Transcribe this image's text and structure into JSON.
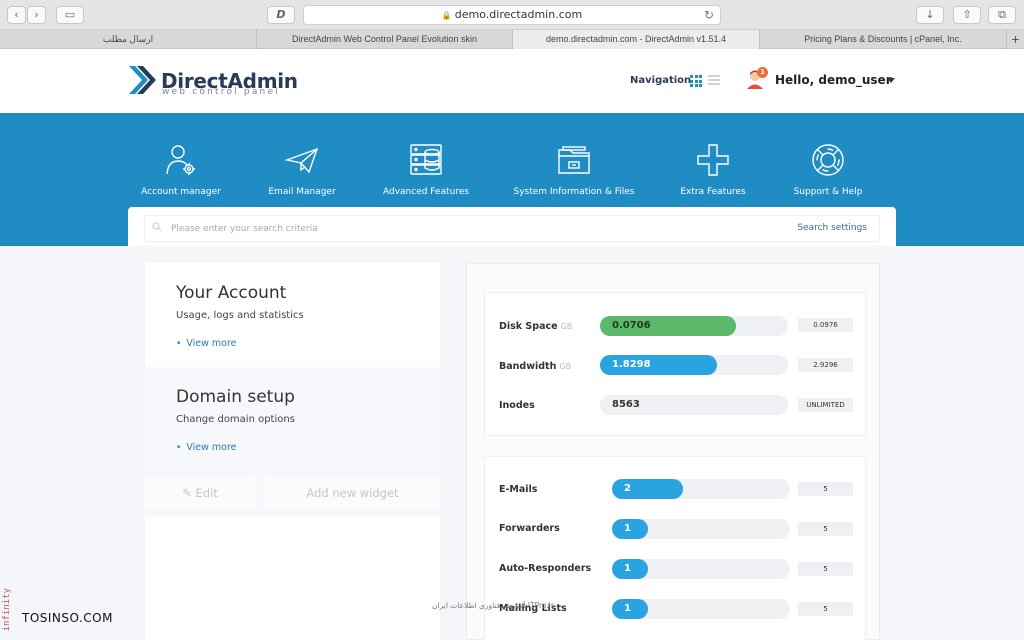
{
  "browser": {
    "url": "demo.directadmin.com",
    "tabs": [
      {
        "label": "ارسال مطلب"
      },
      {
        "label": "DirectAdmin Web Control Panel Evolution skin"
      },
      {
        "label": "demo.directadmin.com - DirectAdmin v1.51.4"
      },
      {
        "label": "Pricing Plans & Discounts | cPanel, Inc."
      }
    ],
    "new_tab": "+",
    "d_logo": "D"
  },
  "header": {
    "brand": "DirectAdmin",
    "brand_sub": "web control panel",
    "navigation_label": "Navigation",
    "notification_count": "1",
    "greeting": "Hello, demo_user"
  },
  "menu": [
    {
      "label": "Account manager",
      "icon": "account-manager-icon"
    },
    {
      "label": "Email Manager",
      "icon": "paper-plane-icon"
    },
    {
      "label": "Advanced Features",
      "icon": "server-database-icon"
    },
    {
      "label": "System Information & Files",
      "icon": "folder-icon"
    },
    {
      "label": "Extra Features",
      "icon": "plus-icon"
    },
    {
      "label": "Support & Help",
      "icon": "lifebuoy-icon"
    }
  ],
  "search": {
    "placeholder": "Please enter your search criteria",
    "settings_label": "Search settings"
  },
  "cards": {
    "account": {
      "title": "Your Account",
      "subtitle": "Usage, logs and statistics",
      "link": "View more"
    },
    "domain": {
      "title": "Domain setup",
      "subtitle": "Change domain options",
      "link": "View more"
    },
    "edit_label": "Edit",
    "add_widget_label": "Add new widget"
  },
  "usage": [
    {
      "label": "Disk Space",
      "unit": "GB",
      "value": "0.0706",
      "limit": "0.0976",
      "fraction": 0.0706,
      "max": 0.0976,
      "color": "#5cb86b"
    },
    {
      "label": "Bandwidth",
      "unit": "GB",
      "value": "1.8298",
      "limit": "2.9296",
      "fraction": 1.8298,
      "max": 2.9296,
      "color": "#2aa4e0"
    },
    {
      "label": "Inodes",
      "unit": "",
      "value": "8563",
      "limit": "UNLIMITED"
    }
  ],
  "email_stats": [
    {
      "label": "E-Mails",
      "value": "2",
      "limit": "5",
      "fraction": 0.4
    },
    {
      "label": "Forwarders",
      "value": "1",
      "limit": "5",
      "fraction": 0.2
    },
    {
      "label": "Auto-Responders",
      "value": "1",
      "limit": "5",
      "fraction": 0.2
    },
    {
      "label": "Mailing Lists",
      "value": "1",
      "limit": "5",
      "fraction": 0.2
    }
  ],
  "overlays": {
    "watermark": "آموزش فناوری اطلاعات ایران ITPro.ir",
    "tosinso": "TOSINSO.COM",
    "infinity": "infinity"
  }
}
